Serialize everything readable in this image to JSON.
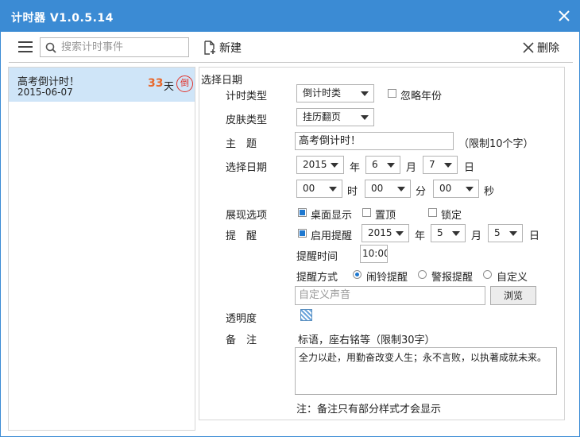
{
  "window": {
    "title": "计时器 V1.0.5.14"
  },
  "toolbar": {
    "search_placeholder": "搜索计时事件",
    "new_label": "新建",
    "delete_label": "删除"
  },
  "events": [
    {
      "title": "高考倒计时！",
      "date": "2015-06-07",
      "days": "33",
      "unit": "天",
      "badge": "倒"
    }
  ],
  "form": {
    "section_title": "选择日期",
    "timer_type": {
      "label": "计时类型",
      "value": "倒计时类",
      "ignore_year_label": "忽略年份",
      "ignore_year": false
    },
    "skin_type": {
      "label": "皮肤类型",
      "value": "挂历翻页"
    },
    "subject": {
      "label": "主　题",
      "value": "高考倒计时！",
      "hint": "（限制10个字）"
    },
    "date": {
      "label": "选择日期",
      "year": "2015",
      "year_unit": "年",
      "month": "6",
      "month_unit": "月",
      "day": "7",
      "day_unit": "日"
    },
    "time": {
      "hour": "00",
      "hour_unit": "时",
      "minute": "00",
      "minute_unit": "分",
      "second": "00",
      "second_unit": "秒"
    },
    "display": {
      "label": "展现选项",
      "desktop_label": "桌面显示",
      "desktop": true,
      "top_label": "置顶",
      "top": false,
      "lock_label": "锁定",
      "lock": false
    },
    "reminder": {
      "label": "提　醒",
      "enable_label": "启用提醒",
      "enabled": true,
      "year": "2015",
      "year_unit": "年",
      "month": "5",
      "month_unit": "月",
      "day": "5",
      "day_unit": "日",
      "time_label": "提醒时间",
      "time_value": "10:00",
      "method_label": "提醒方式",
      "methods": [
        "闹铃提醒",
        "警报提醒",
        "自定义"
      ],
      "selected_method": "闹铃提醒",
      "sound_placeholder": "自定义声音",
      "browse_label": "浏览"
    },
    "opacity": {
      "label": "透明度"
    },
    "note": {
      "label": "备　注",
      "hint": "标语，座右铭等（限制30字）",
      "value": "全力以赴，用勤奋改变人生；永不言败，以执著成就未来。",
      "footer": "注：备注只有部分样式才会显示"
    }
  },
  "colors": {
    "titlebar": "#3b8bd4",
    "selected_row": "#cfe5f8",
    "accent": "#e8682c",
    "stamp": "#e2322a"
  }
}
